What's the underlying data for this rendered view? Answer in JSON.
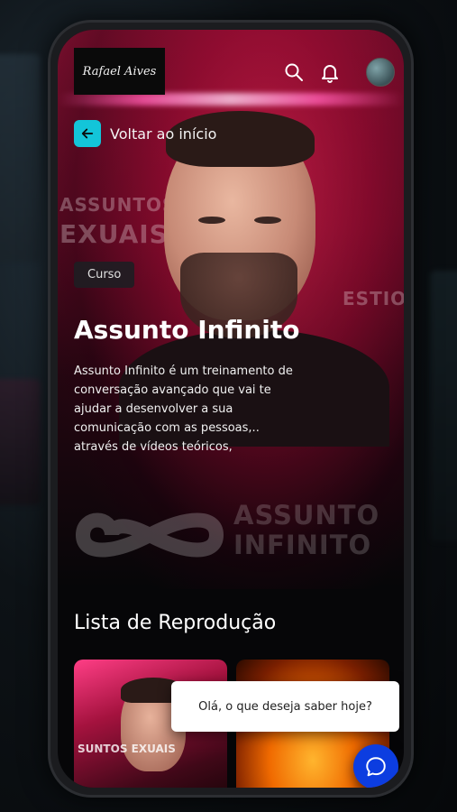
{
  "header": {
    "logo_text": "Rafael Aives",
    "icons": [
      "search-icon",
      "bell-icon",
      "avatar"
    ]
  },
  "back": {
    "label": "Voltar ao início",
    "icon": "arrow-left-icon"
  },
  "hero": {
    "background_texts": [
      "ASSUNTOS",
      "EXUAIS",
      "ESTIO"
    ]
  },
  "course": {
    "badge": "Curso",
    "title": "Assunto Infinito",
    "description": "Assunto Infinito é um treinamento de conversação avançado que vai te ajudar a desenvolver a sua comunicação com as pessoas,.. através de vídeos teóricos,",
    "brand_line1": "ASSUNTO",
    "brand_line2": "INFINITO"
  },
  "playlist": {
    "title": "Lista de Reprodução",
    "cards": [
      {
        "overlay_text": "SUNTOS EXUAIS"
      },
      {
        "overlay_text": ""
      }
    ]
  },
  "chat": {
    "bubble_text": "Olá, o que deseja saber hoje?",
    "fab_icon": "chat-icon"
  },
  "colors": {
    "accent": "#13c5d9",
    "hero_red": "#7b0f2e",
    "chat_blue": "#0c3de0"
  }
}
